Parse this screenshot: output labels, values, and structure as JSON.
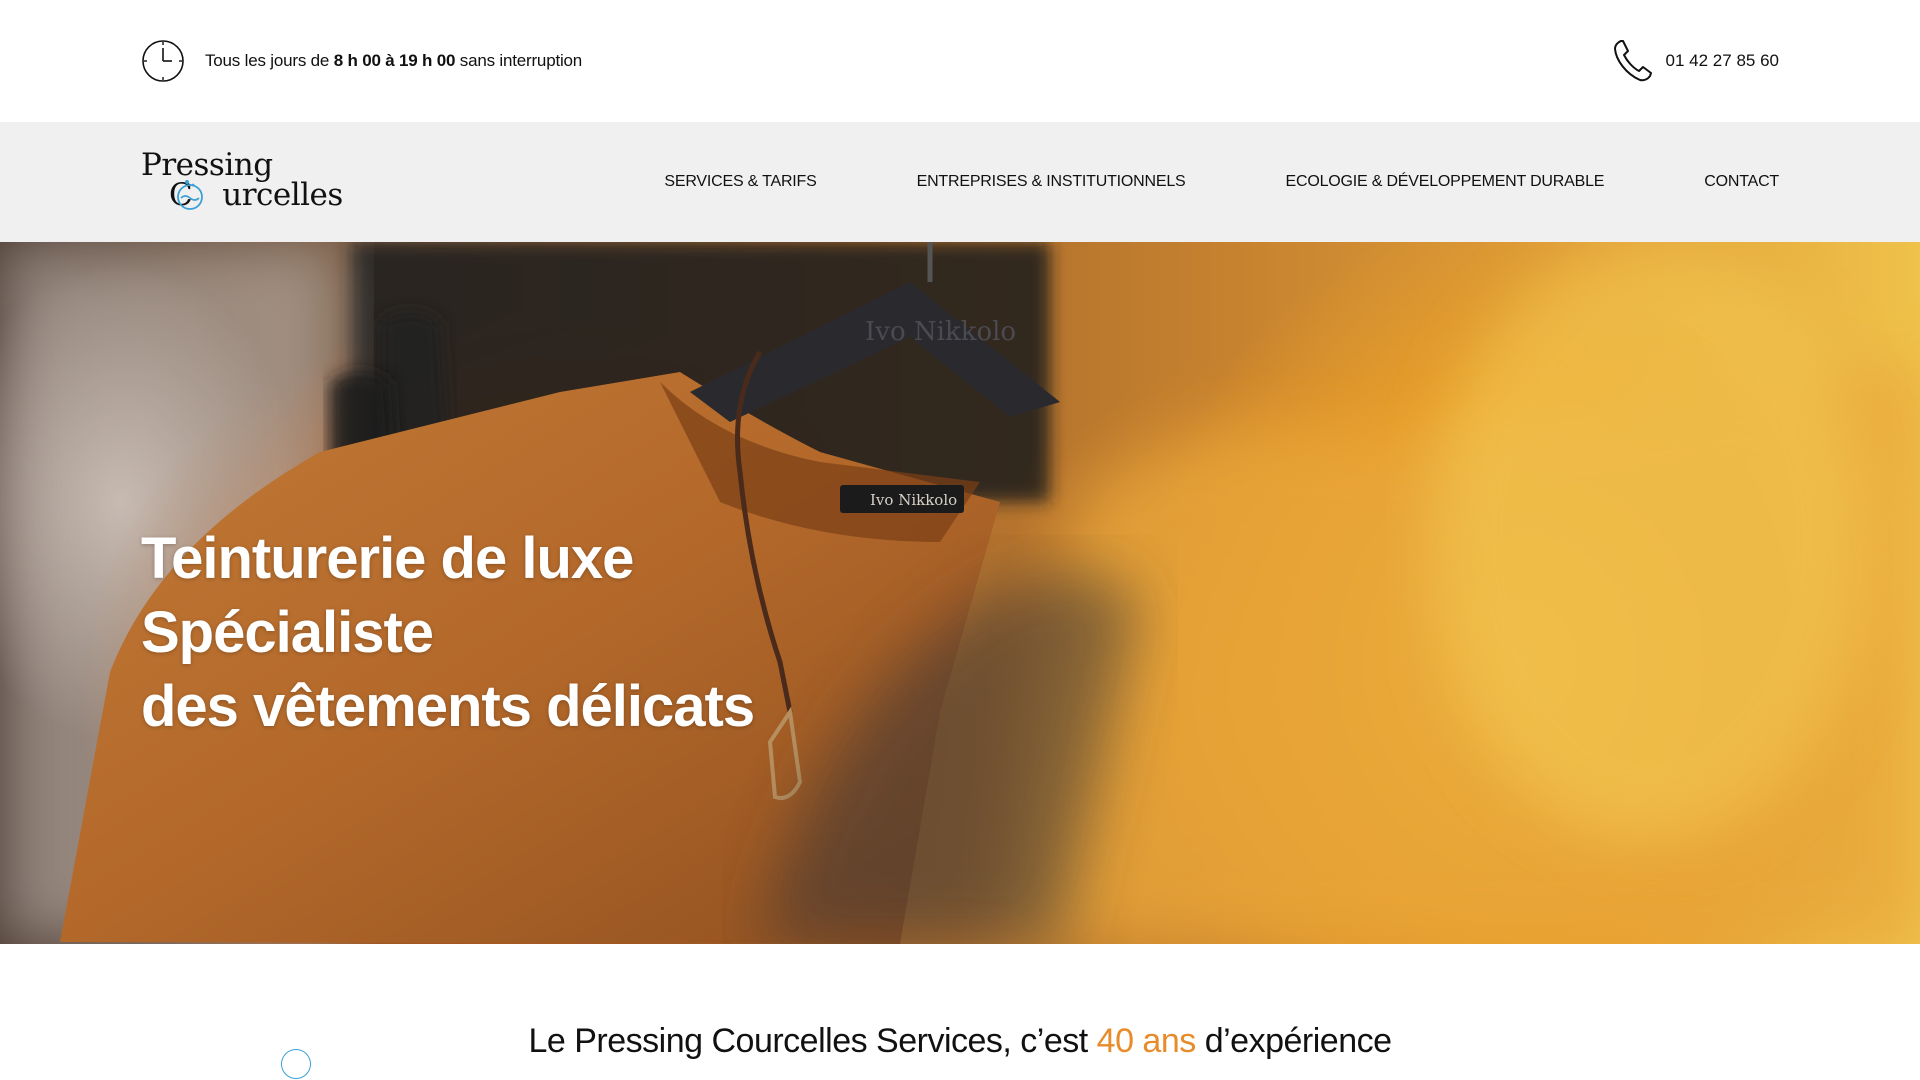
{
  "topbar": {
    "hours_prefix": "Tous les jours de ",
    "hours_bold": "8 h 00 à 19 h 00",
    "hours_suffix": " sans interruption",
    "phone": "01 42 27 85 60",
    "clock_icon": "clock-icon",
    "phone_icon": "phone-icon"
  },
  "logo": {
    "line1": "Pressing",
    "line2": "urcelles",
    "line2_prefix": "C"
  },
  "nav": {
    "items": [
      {
        "label": "SERVICES  & TARIFS"
      },
      {
        "label": "ENTREPRISES & INSTITUTIONNELS"
      },
      {
        "label": "ECOLOGIE  & DÉVELOPPEMENT DURABLE"
      },
      {
        "label": "CONTACT"
      }
    ]
  },
  "hero": {
    "title_line1": "Teinturerie de luxe Spécialiste",
    "title_line2": "des vêtements délicats",
    "hanger_brand": "Ivo Nikkolo",
    "label_brand": "Ivo Nikkolo"
  },
  "intro": {
    "title_before": "Le Pressing Courcelles Services, c’est ",
    "title_accent": "40 ans",
    "title_after": " d’expérience"
  },
  "colors": {
    "accent": "#e88b2a",
    "nav_bg": "#f0f0f0",
    "bubble": "#3aa0d8"
  }
}
